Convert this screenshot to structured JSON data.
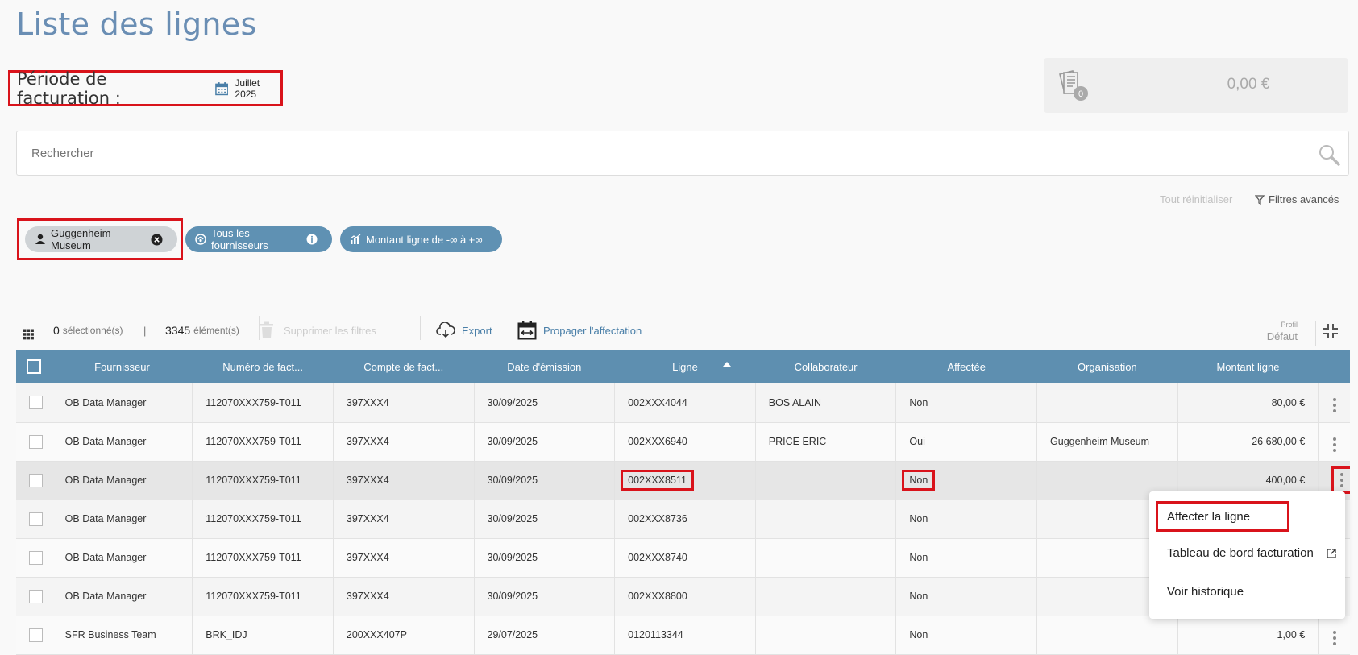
{
  "page": {
    "title": "Liste des lignes"
  },
  "period": {
    "label": "Période de facturation :",
    "value": "Juillet 2025"
  },
  "summary": {
    "badge_count": "0",
    "amount": "0,00 €"
  },
  "search": {
    "placeholder": "Rechercher"
  },
  "filters": {
    "reset_label": "Tout réinitialiser",
    "advanced_label": "Filtres avancés",
    "chips": [
      {
        "label": "Guggenheim Museum"
      },
      {
        "label": "Tous les fournisseurs"
      },
      {
        "label": "Montant ligne de ",
        "range": "-∞ à +∞"
      }
    ]
  },
  "toolbar": {
    "selected_count": "0",
    "selected_label": "sélectionné(s)",
    "separator": "|",
    "total_count": "3345",
    "total_label": "élément(s)",
    "delete_filters": "Supprimer les filtres",
    "export": "Export",
    "propagate": "Propager l'affectation",
    "profile_label": "Profil",
    "profile_value": "Défaut"
  },
  "table": {
    "columns": [
      "Fournisseur",
      "Numéro de fact...",
      "Compte de fact...",
      "Date d'émission",
      "Ligne",
      "Collaborateur",
      "Affectée",
      "Organisation",
      "Montant ligne"
    ],
    "sort_column": "Ligne",
    "rows": [
      {
        "fournisseur": "OB Data Manager",
        "numero": "112070XXX759-T011",
        "compte": "397XXX4",
        "date": "30/09/2025",
        "ligne": "002XXX4044",
        "collaborateur": "BOS ALAIN",
        "affectee": "Non",
        "organisation": "",
        "montant": "80,00 €"
      },
      {
        "fournisseur": "OB Data Manager",
        "numero": "112070XXX759-T011",
        "compte": "397XXX4",
        "date": "30/09/2025",
        "ligne": "002XXX6940",
        "collaborateur": "PRICE ERIC",
        "affectee": "Oui",
        "organisation": "Guggenheim Museum",
        "montant": "26 680,00 €"
      },
      {
        "fournisseur": "OB Data Manager",
        "numero": "112070XXX759-T011",
        "compte": "397XXX4",
        "date": "30/09/2025",
        "ligne": "002XXX8511",
        "collaborateur": "",
        "affectee": "Non",
        "organisation": "",
        "montant": "400,00 €"
      },
      {
        "fournisseur": "OB Data Manager",
        "numero": "112070XXX759-T011",
        "compte": "397XXX4",
        "date": "30/09/2025",
        "ligne": "002XXX8736",
        "collaborateur": "",
        "affectee": "Non",
        "organisation": "",
        "montant": ""
      },
      {
        "fournisseur": "OB Data Manager",
        "numero": "112070XXX759-T011",
        "compte": "397XXX4",
        "date": "30/09/2025",
        "ligne": "002XXX8740",
        "collaborateur": "",
        "affectee": "Non",
        "organisation": "",
        "montant": ""
      },
      {
        "fournisseur": "OB Data Manager",
        "numero": "112070XXX759-T011",
        "compte": "397XXX4",
        "date": "30/09/2025",
        "ligne": "002XXX8800",
        "collaborateur": "",
        "affectee": "Non",
        "organisation": "",
        "montant": ""
      },
      {
        "fournisseur": "SFR Business Team",
        "numero": "BRK_IDJ",
        "compte": "200XXX407P",
        "date": "29/07/2025",
        "ligne": "0120113344",
        "collaborateur": "",
        "affectee": "Non",
        "organisation": "",
        "montant": "1,00 €"
      }
    ]
  },
  "context_menu": {
    "items": [
      {
        "label": "Affecter la ligne"
      },
      {
        "label": "Tableau de bord facturation"
      },
      {
        "label": "Voir historique"
      }
    ]
  },
  "colors": {
    "accent": "#5e8fb0",
    "title": "#6a8eb4",
    "highlight": "#d9131b"
  }
}
